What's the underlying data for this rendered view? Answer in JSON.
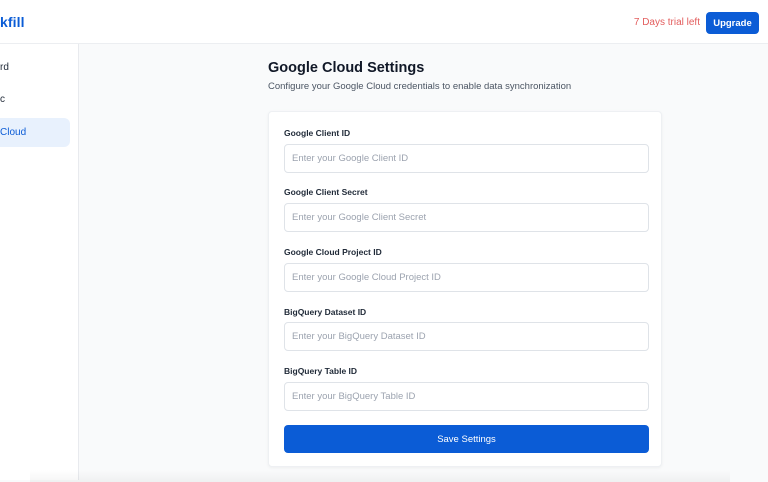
{
  "header": {
    "logo_text": "kfill",
    "trial_text": "7 Days trial left",
    "upgrade_label": "Upgrade"
  },
  "sidebar": {
    "items": [
      {
        "label": "rd",
        "active": false
      },
      {
        "label": "c",
        "active": false
      },
      {
        "label": "Cloud",
        "active": true
      }
    ]
  },
  "main": {
    "title": "Google Cloud Settings",
    "subtitle": "Configure your Google Cloud credentials to enable data synchronization",
    "fields": [
      {
        "label": "Google Client ID",
        "value": "",
        "placeholder": "Enter your Google Client ID"
      },
      {
        "label": "Google Client Secret",
        "value": "",
        "placeholder": "Enter your Google Client Secret"
      },
      {
        "label": "Google Cloud Project ID",
        "value": "",
        "placeholder": "Enter your Google Cloud Project ID"
      },
      {
        "label": "BigQuery Dataset ID",
        "value": "",
        "placeholder": "Enter your BigQuery Dataset ID"
      },
      {
        "label": "BigQuery Table ID",
        "value": "",
        "placeholder": "Enter your BigQuery Table ID"
      }
    ],
    "save_label": "Save Settings"
  },
  "colors": {
    "accent": "#0b5cd6",
    "trial_text": "#e35d5d",
    "active_bg": "#e8f1fd"
  }
}
